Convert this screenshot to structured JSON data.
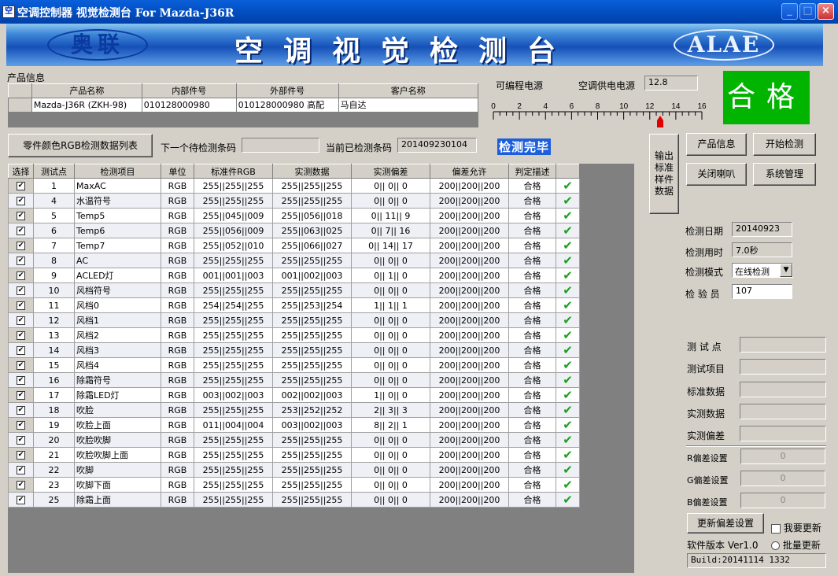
{
  "window": {
    "title": "空调控制器 视觉检测台 For Mazda-J36R",
    "icon_name": "app-icon",
    "controls": {
      "minimize": "_",
      "maximize": "□",
      "close": "×"
    }
  },
  "banner": {
    "logo_left": "奥联",
    "title": "空调视觉检测台",
    "logo_right": "ALAE"
  },
  "product": {
    "section_label": "产品信息",
    "headers": [
      "产品名称",
      "内部件号",
      "外部件号",
      "客户名称"
    ],
    "row": [
      "Mazda-J36R (ZKH-98)",
      "010128000980",
      "010128000980   高配",
      "马自达"
    ]
  },
  "power": {
    "programmable_label": "可编程电源",
    "supply_label": "空调供电电源",
    "supply_value": "12.8",
    "scale_ticks": [
      "0",
      "2",
      "4",
      "6",
      "8",
      "10",
      "12",
      "14",
      "16"
    ],
    "scale_min": 0,
    "scale_max": 16,
    "indicator_value": 12.8
  },
  "result": {
    "text": "合格",
    "color": "#00b400"
  },
  "toolbar": {
    "rgb_list_button": "零件颜色RGB检测数据列表",
    "next_code_label": "下一个待检测条码",
    "next_code_value": "",
    "current_code_label": "当前已检测条码",
    "current_code_value": "201409230104",
    "status_text": "检测完毕"
  },
  "right_buttons": {
    "export_std": "输出标准样件数据",
    "product_info": "产品信息",
    "start_test": "开始检测",
    "close_horn": "关闭喇叭",
    "system_admin": "系统管理"
  },
  "info": {
    "date_label": "检测日期",
    "date_value": "20140923",
    "time_label": "检测用时",
    "time_value": "7.0秒",
    "mode_label": "检测模式",
    "mode_value": "在线检测",
    "inspector_label": "检 验 员",
    "inspector_value": "107"
  },
  "detail": {
    "point_label": "测 试 点",
    "item_label": "测试项目",
    "std_label": "标准数据",
    "actual_label": "实测数据",
    "dev_label": "实测偏差",
    "r_label": "R偏差设置",
    "r_value": "0",
    "g_label": "G偏差设置",
    "g_value": "0",
    "b_label": "B偏差设置",
    "b_value": "0",
    "update_button": "更新偏差设置",
    "want_update_label": "我要更新",
    "batch_update_label": "批量更新",
    "version_label": "软件版本 Ver1.0",
    "build_value": "Build:20141114 1332"
  },
  "grid": {
    "headers": [
      "选择",
      "测试点",
      "检测项目",
      "单位",
      "标准件RGB",
      "实测数据",
      "实测偏差",
      "偏差允许",
      "判定描述",
      ""
    ],
    "rows": [
      [
        "1",
        "MaxAC",
        "RGB",
        "255||255||255",
        "255||255||255",
        "0||  0||  0",
        "200||200||200",
        "合格"
      ],
      [
        "4",
        "水温符号",
        "RGB",
        "255||255||255",
        "255||255||255",
        "0||  0||  0",
        "200||200||200",
        "合格"
      ],
      [
        "5",
        "Temp5",
        "RGB",
        "255||045||009",
        "255||056||018",
        "0|| 11||  9",
        "200||200||200",
        "合格"
      ],
      [
        "6",
        "Temp6",
        "RGB",
        "255||056||009",
        "255||063||025",
        "0||  7|| 16",
        "200||200||200",
        "合格"
      ],
      [
        "7",
        "Temp7",
        "RGB",
        "255||052||010",
        "255||066||027",
        "0|| 14|| 17",
        "200||200||200",
        "合格"
      ],
      [
        "8",
        "AC",
        "RGB",
        "255||255||255",
        "255||255||255",
        "0||  0||  0",
        "200||200||200",
        "合格"
      ],
      [
        "9",
        "ACLED灯",
        "RGB",
        "001||001||003",
        "001||002||003",
        "0||  1||  0",
        "200||200||200",
        "合格"
      ],
      [
        "10",
        "风档符号",
        "RGB",
        "255||255||255",
        "255||255||255",
        "0||  0||  0",
        "200||200||200",
        "合格"
      ],
      [
        "11",
        "风档0",
        "RGB",
        "254||254||255",
        "255||253||254",
        "1||  1||  1",
        "200||200||200",
        "合格"
      ],
      [
        "12",
        "风档1",
        "RGB",
        "255||255||255",
        "255||255||255",
        "0||  0||  0",
        "200||200||200",
        "合格"
      ],
      [
        "13",
        "风档2",
        "RGB",
        "255||255||255",
        "255||255||255",
        "0||  0||  0",
        "200||200||200",
        "合格"
      ],
      [
        "14",
        "风档3",
        "RGB",
        "255||255||255",
        "255||255||255",
        "0||  0||  0",
        "200||200||200",
        "合格"
      ],
      [
        "15",
        "风档4",
        "RGB",
        "255||255||255",
        "255||255||255",
        "0||  0||  0",
        "200||200||200",
        "合格"
      ],
      [
        "16",
        "除霜符号",
        "RGB",
        "255||255||255",
        "255||255||255",
        "0||  0||  0",
        "200||200||200",
        "合格"
      ],
      [
        "17",
        "除霜LED灯",
        "RGB",
        "003||002||003",
        "002||002||003",
        "1||  0||  0",
        "200||200||200",
        "合格"
      ],
      [
        "18",
        "吹脸",
        "RGB",
        "255||255||255",
        "253||252||252",
        "2||  3||  3",
        "200||200||200",
        "合格"
      ],
      [
        "19",
        "吹脸上面",
        "RGB",
        "011||004||004",
        "003||002||003",
        "8||  2||  1",
        "200||200||200",
        "合格"
      ],
      [
        "20",
        "吹脸吹脚",
        "RGB",
        "255||255||255",
        "255||255||255",
        "0||  0||  0",
        "200||200||200",
        "合格"
      ],
      [
        "21",
        "吹脸吹脚上面",
        "RGB",
        "255||255||255",
        "255||255||255",
        "0||  0||  0",
        "200||200||200",
        "合格"
      ],
      [
        "22",
        "吹脚",
        "RGB",
        "255||255||255",
        "255||255||255",
        "0||  0||  0",
        "200||200||200",
        "合格"
      ],
      [
        "23",
        "吹脚下面",
        "RGB",
        "255||255||255",
        "255||255||255",
        "0||  0||  0",
        "200||200||200",
        "合格"
      ],
      [
        "25",
        "除霜上面",
        "RGB",
        "255||255||255",
        "255||255||255",
        "0||  0||  0",
        "200||200||200",
        "合格"
      ]
    ]
  }
}
